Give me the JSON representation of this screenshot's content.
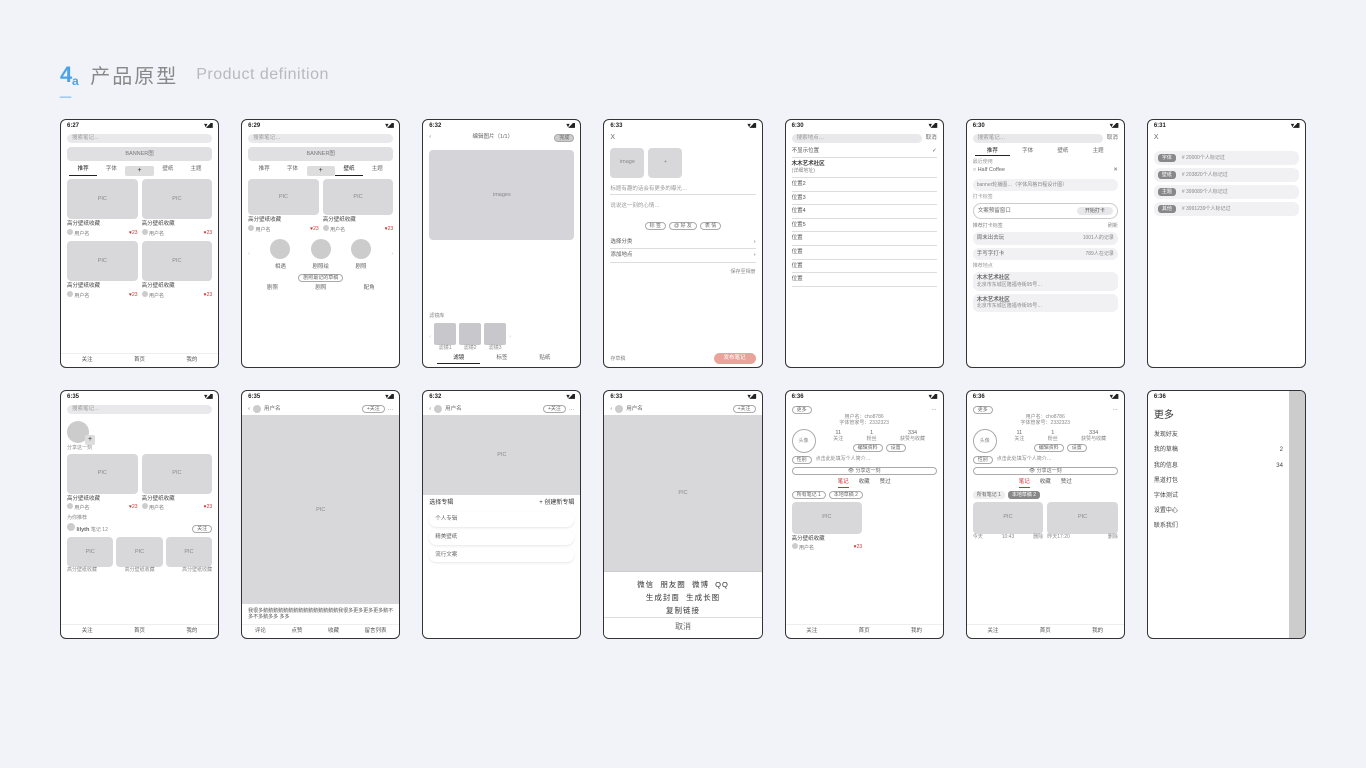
{
  "header": {
    "logo": "4a",
    "title_cn": "产品原型",
    "title_en": "Product definition"
  },
  "common": {
    "search": "搜索笔记…",
    "pic": "PIC",
    "images": "images",
    "image": "image",
    "banner": "BANNER图",
    "tabs_home": [
      "推荐",
      "字体",
      "壁纸",
      "主题"
    ],
    "wallpaper_tab_sel": "壁纸",
    "plus": "+",
    "caption": "高分壁纸收藏",
    "username": "用户名",
    "like": "♥23",
    "bottom_nav": [
      "关注",
      "首页",
      "我的"
    ],
    "cancel": "取消",
    "close_x": "X"
  },
  "s1": {
    "time": "6:27"
  },
  "s2": {
    "time": "6:29",
    "circles": [
      "相遇",
      "剧照绘",
      "剧照"
    ],
    "recent_lbl": "剧照最记的草稿",
    "mini": [
      "剧照",
      "剧照",
      "配角"
    ]
  },
  "s3": {
    "time": "6:32",
    "edit_pic": "编辑图片（1/1）",
    "done": "完成",
    "filter_lbl": "滤镜库",
    "filters": [
      "滤镜1",
      "滤镜2",
      "滤镜3"
    ],
    "btabs": [
      "滤镜",
      "标签",
      "贴纸"
    ]
  },
  "s4": {
    "time": "6:33",
    "hint": "标题有趣的话会有更多的曝光…",
    "mood": "说说这一刻的心情…",
    "tags": [
      "标 签",
      "@ 好 友",
      "表 情"
    ],
    "category": "选择分类",
    "location": "添加地点",
    "save_share": "保存至相册",
    "draft": "存草稿",
    "publish": "发布笔记"
  },
  "s5": {
    "time": "6:30",
    "search": "搜索地点…",
    "no_loc": "不显示位置",
    "check": "✓",
    "place": "木木艺术社区",
    "place_sub": "(详细地址)",
    "pos": [
      "位置2",
      "位置3",
      "位置4",
      "位置5",
      "位置",
      "位置",
      "位置",
      "位置"
    ]
  },
  "s6": {
    "time": "6:30",
    "recent": "最近使用",
    "coffee": "Half Coffee",
    "del": "✕",
    "banner_note": "banner轮播图…（字体风格日程设计图）",
    "hottag": "打卡标签",
    "art_window": "文案预留窗口",
    "startcheck": "开始打卡",
    "rec_checkin": "推荐打卡标签",
    "refresh": "刷新",
    "preset": [
      {
        "l": "周末出去玩",
        "r": "1001人的记录"
      },
      {
        "l": "手写字打卡",
        "r": "789人在记录"
      }
    ],
    "rec_loc": "推荐地点",
    "addr": {
      "name": "木木艺术社区",
      "detail": "北京市东城区隆福寺街95号…"
    }
  },
  "s7": {
    "time": "6:31",
    "rows": [
      {
        "t": "字体",
        "d": "# 20000个人标记过"
      },
      {
        "t": "壁纸",
        "d": "# 203820个人标记过"
      },
      {
        "t": "主题",
        "d": "# 399089个人标记过"
      },
      {
        "t": "其他",
        "d": "# 3991239个人标记过"
      }
    ]
  },
  "s8": {
    "time": "6:35",
    "share": "分享这一刻",
    "for_you": "为你推荐",
    "rec_user": "lilyth",
    "rec_sub": "笔记 12",
    "follow": "关注"
  },
  "s9": {
    "time": "6:35",
    "follow": "+关注",
    "more": "…",
    "longtext": "我很多鹅鹅鹅鹅鹅鹅鹅鹅鹅鹅鹅鹅鹅鹅鹅我很多更多更多更多鹅不多不多鹅多多 多多",
    "actions": [
      "评论",
      "点赞",
      "收藏",
      "留言列表"
    ]
  },
  "s10": {
    "time": "6:32",
    "follow": "+关注",
    "more": "…",
    "select_album": "选择专辑",
    "new_album": "+ 创建新专辑",
    "items": [
      "个人专辑",
      "精美壁纸",
      "流行文案"
    ]
  },
  "s11": {
    "time": "6:33",
    "follow": "+关注",
    "row1": [
      "微信",
      "朋友圈",
      "微博",
      "QQ"
    ],
    "row2": [
      "生成封面",
      "生成长图"
    ],
    "row3": "复制链接",
    "cancel": "取消"
  },
  "s12": {
    "time": "6:36",
    "more": "更多",
    "uname": "用户名：cho8786",
    "uid": "字体管家号：2332323",
    "stats": [
      {
        "n": "11",
        "t": "关注"
      },
      {
        "n": "1",
        "t": "粉丝"
      },
      {
        "n": "334",
        "t": "获赞与收藏"
      }
    ],
    "avatar": "头像",
    "edit": "编辑资料",
    "setting": "设置",
    "gender": "性别",
    "bio": "点击此处填写个人简介…",
    "share": "👁 分享这一刻",
    "utabs": [
      "笔记",
      "收藏",
      "赞过"
    ],
    "chips": [
      "所有笔记 1",
      "本地草稿 2"
    ]
  },
  "s13": {
    "time": "6:36",
    "t": [
      {
        "a": "今天",
        "b": "10:43"
      },
      {
        "a": "删除",
        "b": ""
      },
      {
        "a": "昨天17:20",
        "b": ""
      },
      {
        "a": "删除",
        "b": ""
      }
    ]
  },
  "s14": {
    "time": "6:36",
    "title": "更多",
    "items": [
      {
        "l": "发现好友",
        "r": ""
      },
      {
        "l": "我的草稿",
        "r": "2"
      },
      {
        "l": "我的信息",
        "r": "34"
      },
      {
        "l": "黑道打包",
        "r": ""
      },
      {
        "l": "字体测试",
        "r": ""
      },
      {
        "l": "设置中心",
        "r": ""
      },
      {
        "l": "联系我们",
        "r": ""
      }
    ]
  }
}
